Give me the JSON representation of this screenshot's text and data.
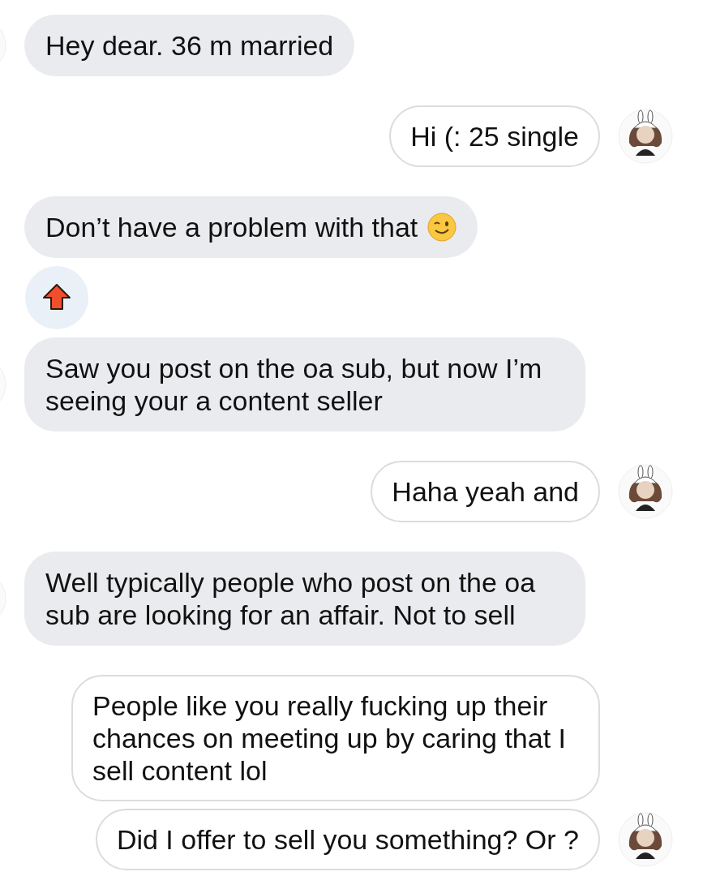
{
  "messages": [
    {
      "kind": "incoming",
      "text": "Hey dear. 36 m married",
      "avatar": true
    },
    {
      "kind": "outgoing",
      "text": "Hi (: 25 single",
      "avatar": true
    },
    {
      "kind": "incoming",
      "text": "Don’t have a problem with that",
      "avatar": false,
      "wink_emoji": true
    },
    {
      "kind": "sticker"
    },
    {
      "kind": "incoming",
      "text": "Saw you post on the oa sub, but now I’m seeing your a content seller",
      "avatar": true
    },
    {
      "kind": "outgoing",
      "text": "Haha yeah and",
      "avatar": true
    },
    {
      "kind": "incoming",
      "text": "Well typically people who post on the oa sub are looking for an affair. Not to sell",
      "avatar": true
    },
    {
      "kind": "outgoing",
      "text": "People like you really fucking up their chances on meeting up by caring that I sell content lol",
      "avatar": false
    },
    {
      "kind": "outgoing",
      "text": "Did I offer to sell you something? Or ?",
      "avatar": true
    }
  ]
}
